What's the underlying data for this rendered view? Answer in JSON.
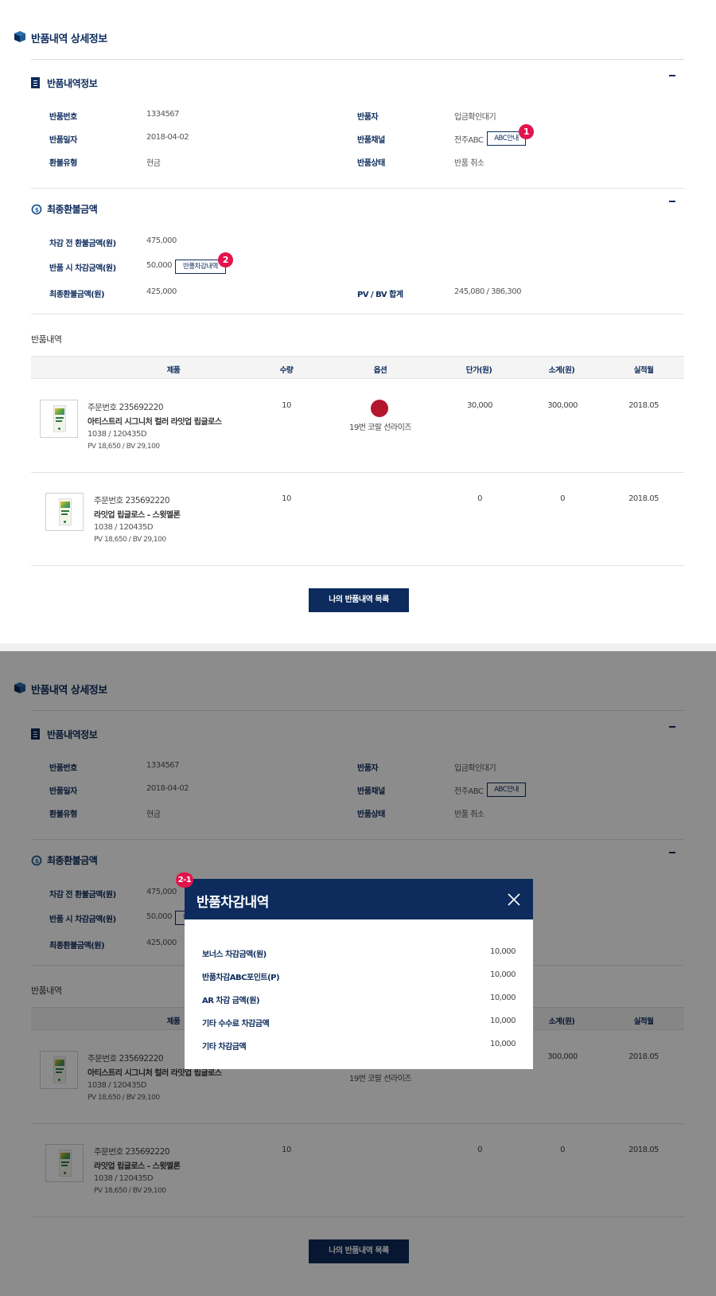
{
  "page_title": "반품내역 상세정보",
  "sections": {
    "info_title": "반품내역정보",
    "refund_title": "최종환불금액",
    "list_title": "반품내역"
  },
  "info": {
    "return_no_label": "반품번호",
    "return_no": "1334567",
    "returner_label": "반품자",
    "returner": "입금확인대기",
    "return_date_label": "반품일자",
    "return_date": "2018-04-02",
    "channel_label": "반품채널",
    "channel": "전주ABC",
    "channel_btn": "ABC안내",
    "refund_type_label": "환불유형",
    "refund_type": "현금",
    "status_label": "반품상태",
    "status": "반품 취소"
  },
  "refund": {
    "before_label": "차감 전 환불금액(원)",
    "before": "475,000",
    "deduct_label": "반품 시 차감금액(원)",
    "deduct": "50,000",
    "deduct_btn": "반품차감내역",
    "final_label": "최종환불금액(원)",
    "final": "425,000",
    "pvbv_label": "PV / BV 합계",
    "pvbv": "245,080 / 386,300"
  },
  "badges": {
    "b1": "1",
    "b2": "2",
    "b21": "2-1"
  },
  "table": {
    "headers": [
      "제품",
      "수량",
      "옵션",
      "단가(원)",
      "소계(원)",
      "실적월"
    ],
    "rows": [
      {
        "order": "주문번호 235692220",
        "name": "아티스트리 시그니처 컬러 라잇업 립글로스",
        "code": "1038 / 120435D",
        "pv": "PV 18,650 / BV 29,100",
        "qty": "10",
        "option": "19번 코랄 선라이즈",
        "price": "30,000",
        "subtotal": "300,000",
        "month": "2018.05"
      },
      {
        "order": "주문번호 235692220",
        "name": "라잇업 립글로스 - 스윗멜론",
        "code": "1038 / 120435D",
        "pv": "PV 18,650 / BV 29,100",
        "qty": "10",
        "option": "",
        "price": "0",
        "subtotal": "0",
        "month": "2018.05"
      }
    ]
  },
  "list_button": "나의 반품내역 목록",
  "modal": {
    "title": "반품차감내역",
    "rows": [
      {
        "label": "보너스 차감금액(원)",
        "value": "10,000"
      },
      {
        "label": "반품차감ABC포인트(P)",
        "value": "10,000"
      },
      {
        "label": "AR 차감 금액(원)",
        "value": "10,000"
      },
      {
        "label": "기타 수수료 차감금액",
        "value": "10,000"
      },
      {
        "label": "기타 차감금액",
        "value": "10,000"
      }
    ]
  },
  "colors": {
    "navy": "#0d2b5c",
    "badge": "#e2134d",
    "swatch": "#b3172d"
  },
  "icons": {
    "page": "box-icon",
    "info": "document-icon",
    "refund": "refund-cycle-icon",
    "close": "close-icon",
    "collapse": "minus-icon"
  }
}
